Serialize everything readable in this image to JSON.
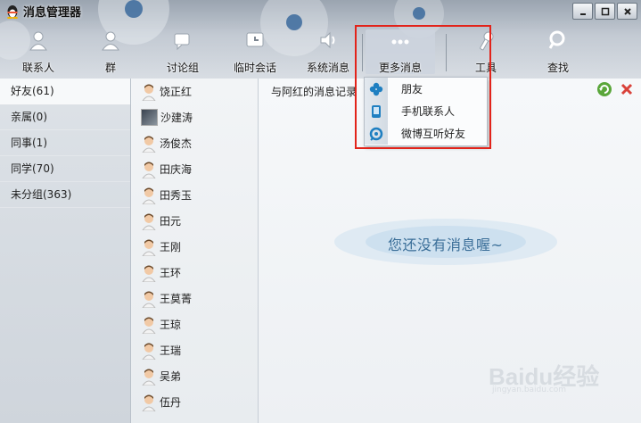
{
  "app": {
    "title": "消息管理器"
  },
  "toolbar": {
    "items": [
      {
        "label": "联系人",
        "icon": "contact-person-icon"
      },
      {
        "label": "群",
        "icon": "group-person-icon"
      },
      {
        "label": "讨论组",
        "icon": "discussion-group-icon"
      },
      {
        "label": "临时会话",
        "icon": "temp-session-icon"
      },
      {
        "label": "系统消息",
        "icon": "speaker-icon"
      },
      {
        "label": "更多消息",
        "icon": "more-dots-icon",
        "active": true
      },
      {
        "label": "工具",
        "icon": "wrench-icon"
      },
      {
        "label": "查找",
        "icon": "magnifier-icon"
      }
    ]
  },
  "groups": [
    {
      "label": "好友(61)",
      "selected": true
    },
    {
      "label": "亲属(0)"
    },
    {
      "label": "同事(1)"
    },
    {
      "label": "同学(70)"
    },
    {
      "label": "未分组(363)"
    }
  ],
  "contacts": [
    {
      "name": "饶正红"
    },
    {
      "name": "沙建涛",
      "photo": true
    },
    {
      "name": "汤俊杰"
    },
    {
      "name": "田庆海"
    },
    {
      "name": "田秀玉"
    },
    {
      "name": "田元"
    },
    {
      "name": "王刚"
    },
    {
      "name": "王环"
    },
    {
      "name": "王莫菁"
    },
    {
      "name": "王琼"
    },
    {
      "name": "王瑞"
    },
    {
      "name": "吴弟"
    },
    {
      "name": "伍丹"
    }
  ],
  "main": {
    "record_title": "与阿红的消息记录",
    "empty_message": "您还没有消息喔~"
  },
  "dropdown": {
    "items": [
      {
        "label": "朋友",
        "icon": "friend-clover-icon"
      },
      {
        "label": "手机联系人",
        "icon": "mobile-phone-icon"
      },
      {
        "label": "微博互听好友",
        "icon": "weibo-icon"
      }
    ]
  },
  "watermark": {
    "text": "Baidu经验",
    "sub": "jingyan.baidu.com"
  },
  "colors": {
    "highlight": "#e2231a",
    "accent": "#3a6e98",
    "selected_bg": "#f7f9fa"
  }
}
